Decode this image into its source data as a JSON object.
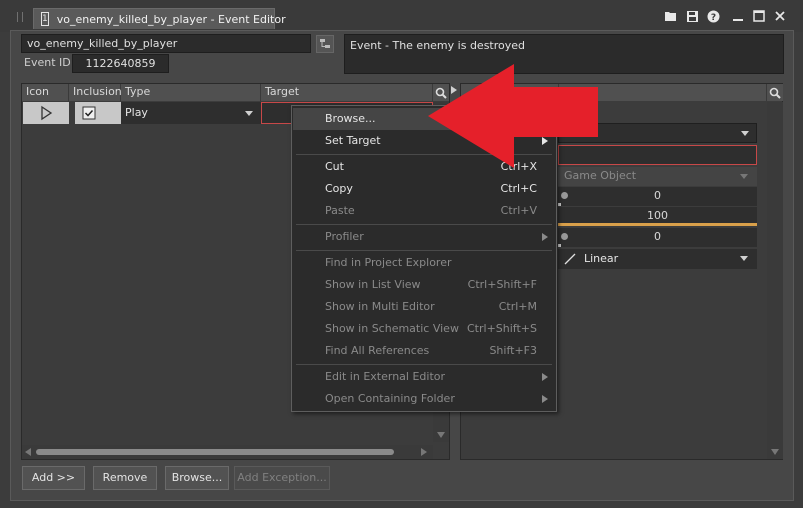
{
  "window": {
    "tab_title": "vo_enemy_killed_by_player - Event Editor",
    "tab_icon_glyph": "1",
    "buttons": [
      "folder-icon",
      "save-icon",
      "help-icon",
      "minimize-icon",
      "maximize-icon",
      "close-icon"
    ]
  },
  "event": {
    "name": "vo_enemy_killed_by_player",
    "id_label": "Event ID",
    "id_value": "1122640859",
    "description": "Event - The enemy is destroyed"
  },
  "table": {
    "headers": [
      "Icon",
      "Inclusion",
      "Type",
      "Target"
    ],
    "row": {
      "type": "Play",
      "target": ""
    }
  },
  "right_panel": {
    "scope_value": "Game Object",
    "slider1": "0",
    "slider2": "100",
    "slider3": "0",
    "curve": "Linear"
  },
  "bottom_buttons": {
    "add": "Add >>",
    "remove": "Remove",
    "browse": "Browse...",
    "add_exception": "Add Exception..."
  },
  "context_menu": {
    "items": [
      {
        "label": "Browse...",
        "shortcut": "",
        "disabled": false,
        "highlight": true,
        "submenu": false
      },
      {
        "label": "Set Target",
        "shortcut": "",
        "disabled": false,
        "highlight": false,
        "submenu": true
      },
      {
        "label": "Cut",
        "shortcut": "Ctrl+X",
        "disabled": false,
        "highlight": false,
        "submenu": false
      },
      {
        "label": "Copy",
        "shortcut": "Ctrl+C",
        "disabled": false,
        "highlight": false,
        "submenu": false
      },
      {
        "label": "Paste",
        "shortcut": "Ctrl+V",
        "disabled": true,
        "highlight": false,
        "submenu": false
      },
      {
        "label": "Profiler",
        "shortcut": "",
        "disabled": true,
        "highlight": false,
        "submenu": true
      },
      {
        "label": "Find in Project Explorer",
        "shortcut": "",
        "disabled": true,
        "highlight": false,
        "submenu": false
      },
      {
        "label": "Show in List View",
        "shortcut": "Ctrl+Shift+F",
        "disabled": true,
        "highlight": false,
        "submenu": false
      },
      {
        "label": "Show in Multi Editor",
        "shortcut": "Ctrl+M",
        "disabled": true,
        "highlight": false,
        "submenu": false
      },
      {
        "label": "Show in Schematic View",
        "shortcut": "Ctrl+Shift+S",
        "disabled": true,
        "highlight": false,
        "submenu": false
      },
      {
        "label": "Find All References",
        "shortcut": "Shift+F3",
        "disabled": true,
        "highlight": false,
        "submenu": false
      },
      {
        "label": "Edit in External Editor",
        "shortcut": "",
        "disabled": true,
        "highlight": false,
        "submenu": true
      },
      {
        "label": "Open Containing Folder",
        "shortcut": "",
        "disabled": true,
        "highlight": false,
        "submenu": true
      }
    ]
  },
  "colors": {
    "annotation_arrow": "#e5202a",
    "highlight_border": "#c84848",
    "slider_accent": "#d9a04a"
  }
}
